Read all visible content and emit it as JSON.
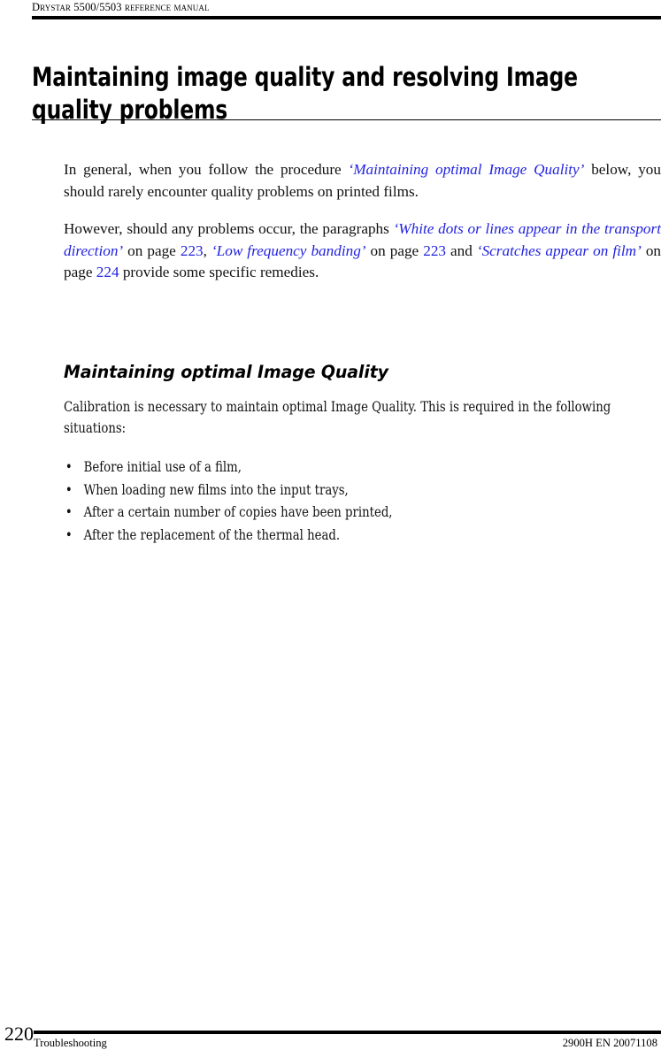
{
  "header": {
    "running_title": "DRYSTAR 5500/5503 REFERENCE MANUAL"
  },
  "title": {
    "text": "Maintaining image quality and resolving Image quality problems"
  },
  "colors": {
    "link": "#2222e0",
    "text": "#111111",
    "rule": "#000000"
  },
  "body": {
    "paragraph1": {
      "part1": "In general, when you follow the procedure ",
      "link1": "‘Maintaining optimal Image Quality’",
      "part2": " below, you should rarely encounter quality problems on printed films."
    },
    "paragraph2": {
      "part1": "However, should any problems occur, the paragraphs ",
      "link1": "‘White dots or lines appear in the transport direction’",
      "part2": " on page ",
      "pageref1": "223",
      "part3": ", ",
      "link2": "‘Low frequency banding’",
      "part4": " on page ",
      "pageref2": "223",
      "part5": " and ",
      "link3": "‘Scratches appear on film’",
      "part6": " on page ",
      "pageref3": "224",
      "part7": " provide some specific remedies."
    }
  },
  "section": {
    "heading": "Maintaining optimal Image Quality",
    "intro": "Calibration is necessary to maintain optimal Image Quality. This is required in the following situations:",
    "bullet_glyph": "•",
    "bullets": [
      "Before initial use of a film,",
      "When loading new films into the input trays,",
      "After a certain number of copies have been printed,",
      "After the replacement of the thermal head."
    ]
  },
  "footer": {
    "page_number": "220",
    "chapter_label": "Troubleshooting",
    "document_code": "2900H EN 20071108"
  }
}
